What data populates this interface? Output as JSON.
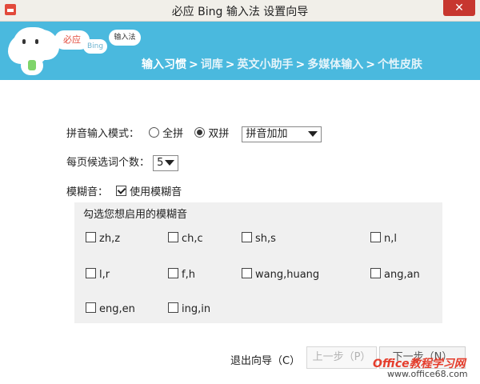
{
  "window": {
    "title": "必应 Bing 输入法 设置向导",
    "close_label": "✕"
  },
  "banner": {
    "bubble_main": "必应",
    "bubble_bing": "Bing",
    "bubble_input": "输入法",
    "steps": [
      {
        "label": "输入习惯"
      },
      {
        "label": "词库"
      },
      {
        "label": "英文小助手"
      },
      {
        "label": "多媒体输入"
      },
      {
        "label": "个性皮肤"
      }
    ],
    "separator": ">"
  },
  "pinyin": {
    "label": "拼音输入模式：",
    "options": [
      "全拼",
      "双拼"
    ],
    "selected_option": "双拼",
    "scheme_value": "拼音加加"
  },
  "candidates": {
    "label": "每页候选词个数：",
    "value": "5"
  },
  "fuzzy": {
    "label": "模糊音：",
    "enable_label": "使用模糊音",
    "panel_title": "勾选您想启用的模糊音",
    "items": [
      "zh,z",
      "ch,c",
      "sh,s",
      "n,l",
      "l,r",
      "f,h",
      "wang,huang",
      "ang,an",
      "eng,en",
      "ing,in"
    ]
  },
  "footer": {
    "exit_label": "退出向导（C）",
    "prev_label": "上一步（P）",
    "next_label": "下一步（N）"
  },
  "watermark": {
    "line1": "Office教程学习网",
    "line2": "www.office68.com"
  },
  "colors": {
    "banner": "#4ab9de",
    "close": "#c7372f"
  }
}
